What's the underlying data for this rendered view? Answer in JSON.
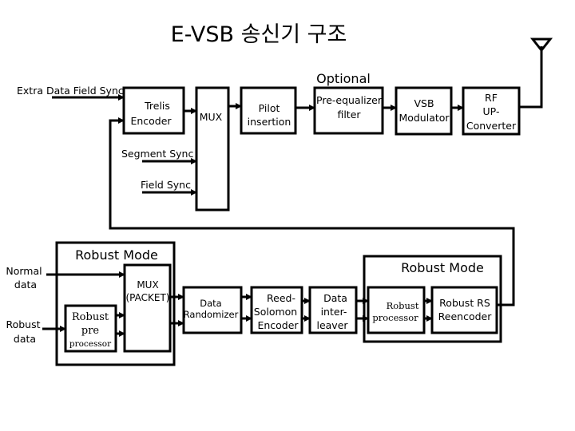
{
  "title": "E-VSB 송신기 구조",
  "labels": {
    "optional": "Optional",
    "extra_data_field_sync": "Extra Data Field Sync",
    "segment_sync": "Segment Sync",
    "field_sync": "Field Sync",
    "normal_data": [
      "Normal",
      "data"
    ],
    "robust_data": [
      "Robust",
      "data"
    ],
    "robust_mode_left": "Robust  Mode",
    "robust_mode_right": "Robust  Mode"
  },
  "blocks": {
    "trelis_encoder": [
      "Trelis",
      "Encoder"
    ],
    "mux": [
      "MUX"
    ],
    "pilot_insertion": [
      "Pilot",
      "insertion"
    ],
    "pre_equalizer": [
      "Pre-equalizer",
      "filter"
    ],
    "vsb_modulator": [
      "VSB",
      "Modulator"
    ],
    "rf_upconverter": [
      "RF",
      "UP-",
      "Converter"
    ],
    "mux_packet": [
      "MUX",
      "(PACKET)"
    ],
    "robust_preprocessor": [
      "Robust",
      "pre",
      "processor"
    ],
    "data_randomizer": [
      "Data",
      "Randomizer"
    ],
    "reed_solomon": [
      "Reed-",
      "Solomon",
      "Encoder"
    ],
    "data_interleaver": [
      "Data",
      "inter-",
      "leaver"
    ],
    "robust_processor": [
      "Robust",
      "processor"
    ],
    "robust_rs_reencoder": [
      "Robust RS",
      "Reencoder"
    ]
  },
  "icons": {
    "antenna": "antenna-icon"
  }
}
